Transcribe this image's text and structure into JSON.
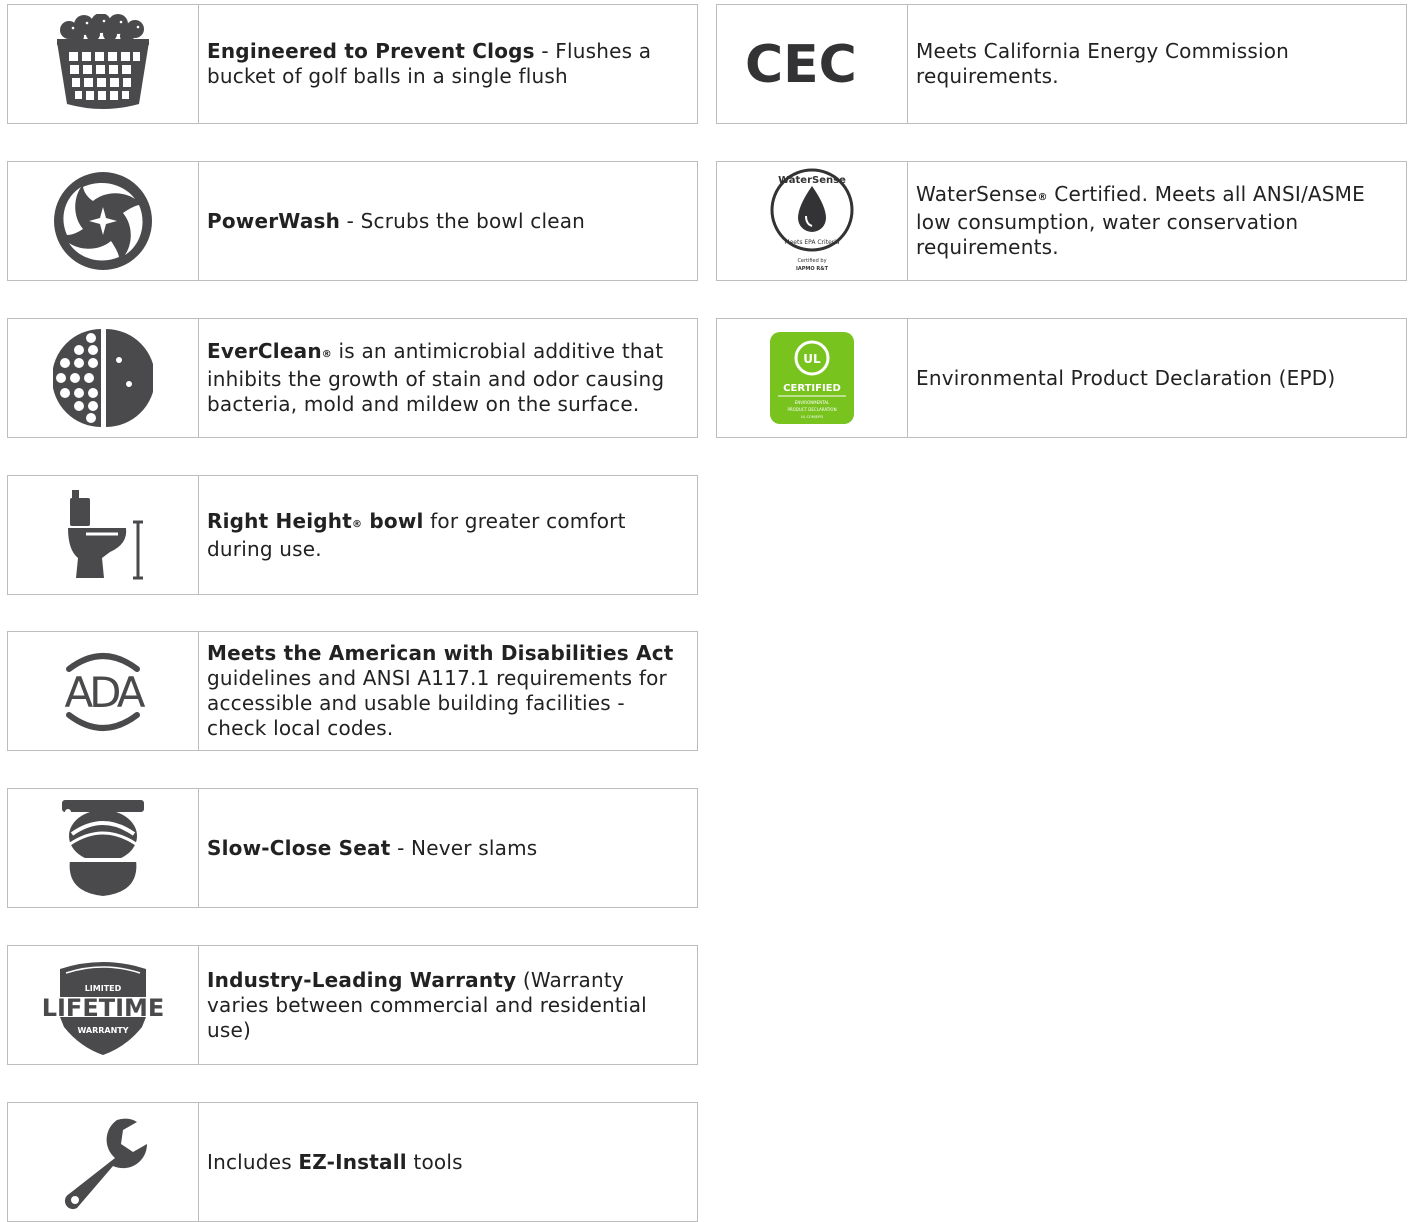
{
  "colors": {
    "icon_gray": "#4a4a4c",
    "border": "#bdbdbd",
    "ul_green": "#78c31e",
    "text": "#222222"
  },
  "features": [
    {
      "icon": "golf-ball-basket-icon",
      "bold": "Engineered to Prevent Clogs",
      "text": " - Flushes a bucket of golf balls in a single flush"
    },
    {
      "icon": "powerwash-swirl-icon",
      "bold": "PowerWash",
      "text": " - Scrubs the bowl clean"
    },
    {
      "icon": "everclean-surface-icon",
      "bold": "EverClean",
      "reg": "®",
      "text": " is an antimicrobial additive that inhibits the growth of stain and odor causing bacteria, mold and mildew on the surface."
    },
    {
      "icon": "right-height-toilet-icon",
      "bold_a": "Right Height",
      "reg": "®",
      "bold_b": " bowl",
      "text": " for greater comfort during use."
    },
    {
      "icon": "ada-icon",
      "icon_label": "ADA",
      "bold": "Meets the American with Disabilities Act",
      "text": " guidelines and ANSI A117.1 requirements for accessible and usable building facilities - check local codes."
    },
    {
      "icon": "slow-close-seat-icon",
      "bold": "Slow-Close Seat",
      "text": " - Never slams"
    },
    {
      "icon": "lifetime-warranty-badge-icon",
      "badge_top": "LIMITED",
      "badge_main": "LIFETIME",
      "badge_bottom": "WARRANTY",
      "bold": "Industry-Leading Warranty",
      "text": " (Warranty varies between commercial and residential use)"
    },
    {
      "icon": "wrench-icon",
      "pre": "Includes ",
      "bold": "EZ-Install",
      "text": " tools"
    }
  ],
  "certifications": [
    {
      "icon": "cec-logo-icon",
      "logo_text": "CEC",
      "text": "Meets California Energy Commission requirements."
    },
    {
      "icon": "watersense-logo-icon",
      "logo_ring_top": "WaterSense",
      "logo_ring_bottom": "Meets EPA Criteria",
      "logo_small_1": "Certified by",
      "logo_small_2": "IAPMO R&T",
      "name": "WaterSense",
      "reg": "®",
      "text": " Certified. Meets all ANSI/ASME low consumption, water conservation requirements."
    },
    {
      "icon": "ul-certified-logo-icon",
      "logo_ul": "UL",
      "logo_title": "CERTIFIED",
      "logo_sub_1": "ENVIRONMENTAL",
      "logo_sub_2": "PRODUCT DECLARATION",
      "logo_sub_3": "UL.COM/EPD",
      "text": "Environmental Product Declaration (EPD)"
    }
  ]
}
